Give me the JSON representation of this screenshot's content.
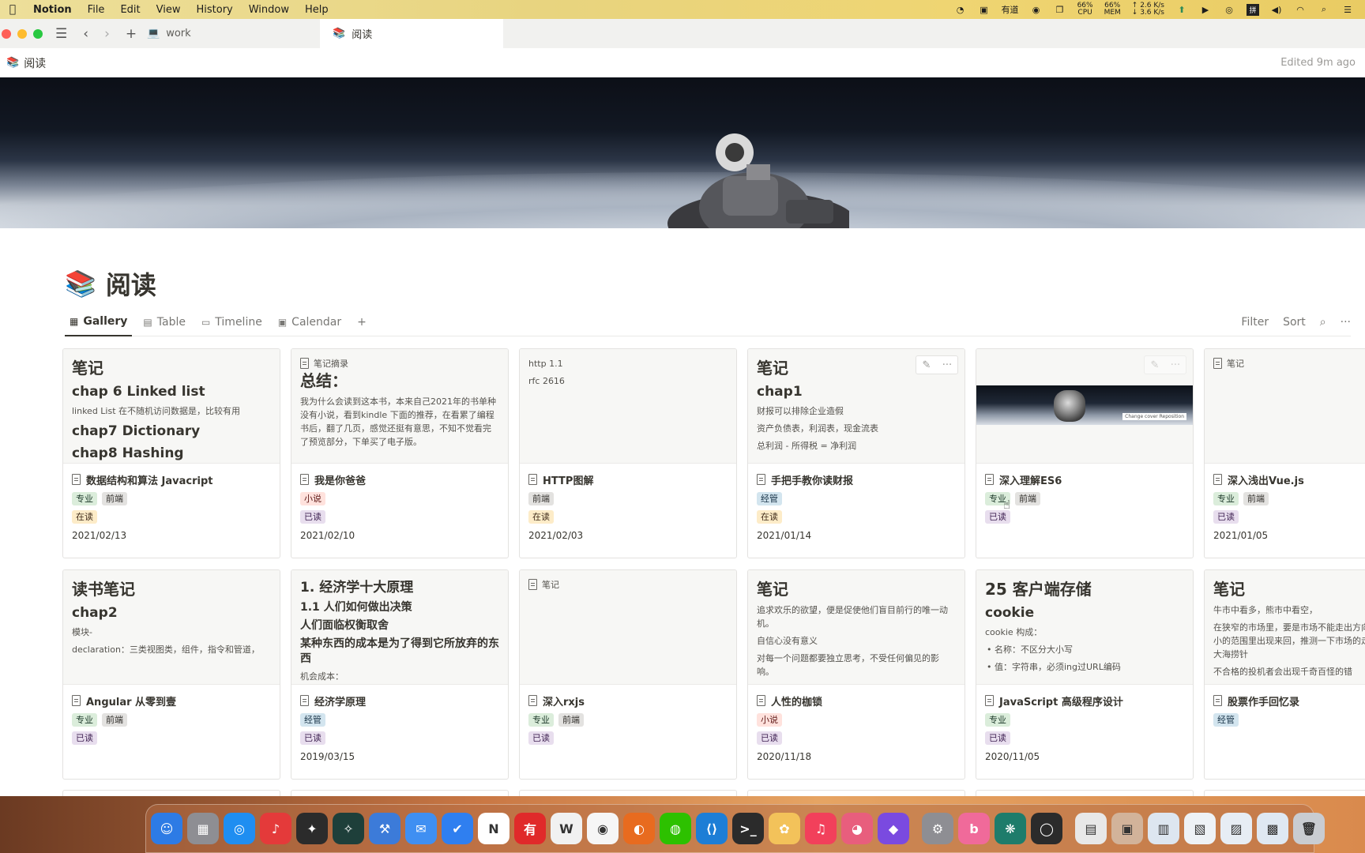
{
  "menubar": {
    "app": "Notion",
    "menus": [
      "File",
      "Edit",
      "View",
      "History",
      "Window",
      "Help"
    ],
    "status": {
      "youdao": "有道",
      "cpu": "66%",
      "cpu_label": "CPU",
      "mem": "66%",
      "mem_label": "MEM",
      "net_up": "↑ 2.6 K/s",
      "net_down": "↓ 3.6 K/s"
    }
  },
  "tabs": [
    {
      "label": "work",
      "icon": "laptop-icon"
    },
    {
      "label": "阅读",
      "icon": "books-icon"
    }
  ],
  "page": {
    "breadcrumb": "阅读",
    "edited": "Edited 9m ago",
    "title": "阅读",
    "emoji": "📚"
  },
  "views": {
    "tabs": [
      "Gallery",
      "Table",
      "Timeline",
      "Calendar"
    ],
    "active": "Gallery",
    "filter": "Filter",
    "sort": "Sort"
  },
  "tag_colors": {
    "专业": {
      "bg": "#dbeddb",
      "fg": "#1c3829"
    },
    "前端": {
      "bg": "#e3e2e0",
      "fg": "#32302c"
    },
    "小说": {
      "bg": "#ffe2dd",
      "fg": "#5d1715"
    },
    "经管": {
      "bg": "#d3e5ef",
      "fg": "#183347"
    },
    "在读": {
      "bg": "#fdecc8",
      "fg": "#402c1b"
    },
    "已读": {
      "bg": "#e8deee",
      "fg": "#412454"
    }
  },
  "cards": [
    {
      "preview": [
        {
          "t": "h1",
          "text": "笔记"
        },
        {
          "t": "h2",
          "text": "chap 6 Linked list"
        },
        {
          "t": "p",
          "text": "linked List  在不随机访问数据是，比较有用"
        },
        {
          "t": "h2",
          "text": "chap7 Dictionary"
        },
        {
          "t": "h2",
          "text": "chap8 Hashing"
        }
      ],
      "title": "数据结构和算法 Javacript",
      "tags": [
        "专业",
        "前端"
      ],
      "status": "在读",
      "date": "2021/02/13"
    },
    {
      "preview": [
        {
          "t": "small",
          "text": "笔记摘录"
        },
        {
          "t": "h1",
          "text": "总结："
        },
        {
          "t": "p",
          "text": "我为什么会读到这本书，本来自己2021年的书单种没有小说，看到kindle 下面的推荐，在看累了编程书后，翻了几页，感觉还挺有意思，不知不觉看完了预览部分，下单买了电子版。"
        }
      ],
      "title": "我是你爸爸",
      "tags": [
        "小说"
      ],
      "status": "已读",
      "date": "2021/02/10"
    },
    {
      "preview": [
        {
          "t": "p",
          "text": "http 1.1"
        },
        {
          "t": "p",
          "text": "rfc 2616"
        }
      ],
      "title": "HTTP图解",
      "tags": [
        "前端"
      ],
      "status": "在读",
      "date": "2021/02/03"
    },
    {
      "preview": [
        {
          "t": "h1",
          "text": "笔记"
        },
        {
          "t": "h2",
          "text": "chap1"
        },
        {
          "t": "p",
          "text": "财报可以排除企业造假"
        },
        {
          "t": "p",
          "text": "资产负债表，利润表，现金流表"
        },
        {
          "t": "p",
          "text": "总利润 - 所得税 = 净利润"
        }
      ],
      "title": "手把手教你读财报",
      "tags": [
        "经管"
      ],
      "status": "在读",
      "date": "2021/01/14",
      "actions": true
    },
    {
      "preview": [],
      "image": true,
      "image_caption": "Change cover  Reposition",
      "title": "深入理解ES6",
      "tags": [
        "专业",
        "前端"
      ],
      "status": "已读",
      "date": "",
      "actions": true
    },
    {
      "preview": [
        {
          "t": "small",
          "text": "笔记"
        }
      ],
      "title": "深入浅出Vue.js",
      "tags": [
        "专业",
        "前端"
      ],
      "status": "已读",
      "date": "2021/01/05"
    },
    {
      "preview": [
        {
          "t": "h1",
          "text": "读书笔记"
        },
        {
          "t": "h2",
          "text": "chap2"
        },
        {
          "t": "p",
          "text": "模块-"
        },
        {
          "t": "p",
          "text": "declaration：三类视图类，组件，指令和管道，"
        }
      ],
      "title": "Angular 从零到壹",
      "tags": [
        "专业",
        "前端"
      ],
      "status": "已读",
      "date": ""
    },
    {
      "preview": [
        {
          "t": "h2",
          "text": "1. 经济学十大原理"
        },
        {
          "t": "h3",
          "text": "1.1 人们如何做出决策"
        },
        {
          "t": "h3",
          "text": "人们面临权衡取舍"
        },
        {
          "t": "h3",
          "text": "某种东西的成本是为了得到它所放弃的东西"
        },
        {
          "t": "p",
          "text": "机会成本："
        }
      ],
      "title": "经济学原理",
      "tags": [
        "经管"
      ],
      "status": "已读",
      "date": "2019/03/15"
    },
    {
      "preview": [
        {
          "t": "small",
          "text": "笔记"
        }
      ],
      "title": "深入rxjs",
      "tags": [
        "专业",
        "前端"
      ],
      "status": "已读",
      "date": ""
    },
    {
      "preview": [
        {
          "t": "h1",
          "text": "笔记"
        },
        {
          "t": "p",
          "text": "追求欢乐的欲望，便是促使他们盲目前行的唯一动机。"
        },
        {
          "t": "p",
          "text": "自信心没有意义"
        },
        {
          "t": "p",
          "text": "对每一个问题都要独立思考，不受任何偏见的影响。"
        }
      ],
      "title": "人性的枷锁",
      "tags": [
        "小说"
      ],
      "status": "已读",
      "date": "2020/11/18"
    },
    {
      "preview": [
        {
          "t": "h1",
          "text": "25 客户端存储"
        },
        {
          "t": "h2",
          "text": "cookie"
        },
        {
          "t": "p",
          "text": "cookie 构成："
        },
        {
          "t": "li",
          "text": "名称：不区分大小写"
        },
        {
          "t": "li",
          "text": "值：字符串，必须ing过URL编码"
        }
      ],
      "title": "JavaScript 高级程序设计",
      "tags": [
        "专业"
      ],
      "status": "已读",
      "date": "2020/11/05"
    },
    {
      "preview": [
        {
          "t": "h1",
          "text": "笔记"
        },
        {
          "t": "p",
          "text": "牛市中看多，熊市中看空，"
        },
        {
          "t": "p",
          "text": "在狭窄的市场里，要是市场不能走出方向，总在这么小的范围里出现来回，推测一下市场的走势，无异于大海捞针"
        },
        {
          "t": "p",
          "text": "不合格的投机者会出现千奇百怪的错"
        }
      ],
      "title": "股票作手回忆录",
      "tags": [
        "经管"
      ],
      "status": "",
      "date": ""
    }
  ],
  "dock": {
    "apps": [
      {
        "name": "finder-icon",
        "color": "#2d7be5",
        "glyph": "☺"
      },
      {
        "name": "launchpad-icon",
        "color": "#8e8e93",
        "glyph": "▦"
      },
      {
        "name": "safari-icon",
        "color": "#1f8ef1",
        "glyph": "◎"
      },
      {
        "name": "netease-music-icon",
        "color": "#e43a3a",
        "glyph": "♪"
      },
      {
        "name": "game-icon",
        "color": "#2b2b2b",
        "glyph": "✦"
      },
      {
        "name": "feather-icon",
        "color": "#1e3f3a",
        "glyph": "✧"
      },
      {
        "name": "xcode-icon",
        "color": "#3c7bd9",
        "glyph": "⚒"
      },
      {
        "name": "mail-icon",
        "color": "#3f8ff2",
        "glyph": "✉"
      },
      {
        "name": "todo-icon",
        "color": "#2f7ff0",
        "glyph": "✔"
      },
      {
        "name": "notion-icon",
        "color": "#ffffff",
        "glyph": "N"
      },
      {
        "name": "youdao-icon",
        "color": "#e02a2a",
        "glyph": "有"
      },
      {
        "name": "wps-icon",
        "color": "#f1f1f1",
        "glyph": "W"
      },
      {
        "name": "chrome-icon",
        "color": "#f6f6f6",
        "glyph": "◉"
      },
      {
        "name": "firefox-icon",
        "color": "#e86b1f",
        "glyph": "◐"
      },
      {
        "name": "wechat-icon",
        "color": "#2dc100",
        "glyph": "◍"
      },
      {
        "name": "vscode-icon",
        "color": "#1d7ed6",
        "glyph": "⟨⟩"
      },
      {
        "name": "terminal-icon",
        "color": "#2b2b2b",
        "glyph": ">_"
      },
      {
        "name": "paw-icon",
        "color": "#f3c25a",
        "glyph": "✿"
      },
      {
        "name": "music-icon",
        "color": "#f2405b",
        "glyph": "♫"
      },
      {
        "name": "mindnode-icon",
        "color": "#e85e7d",
        "glyph": "◕"
      },
      {
        "name": "obsidian-icon",
        "color": "#7a4ae0",
        "glyph": "◆"
      },
      {
        "name": "system-preferences-icon",
        "color": "#8e8e93",
        "glyph": "⚙"
      },
      {
        "name": "bilibili-icon",
        "color": "#f06a9a",
        "glyph": "b"
      },
      {
        "name": "paw-print-icon",
        "color": "#1e7c6b",
        "glyph": "❋"
      },
      {
        "name": "obs-icon",
        "color": "#2b2b2b",
        "glyph": "◯"
      },
      {
        "name": "downloads-folder-icon",
        "color": "#e8e8e8",
        "glyph": "▤"
      },
      {
        "name": "photo-folder-icon",
        "color": "#d2b39a",
        "glyph": "▣"
      },
      {
        "name": "screenshots-folder-icon",
        "color": "#dde6f0",
        "glyph": "▥"
      },
      {
        "name": "documents-folder-icon",
        "color": "#eef2f6",
        "glyph": "▧"
      },
      {
        "name": "files-folder-icon",
        "color": "#e7edf4",
        "glyph": "▨"
      },
      {
        "name": "grid-folder-icon",
        "color": "#dfe8f2",
        "glyph": "▩"
      },
      {
        "name": "trash-icon",
        "color": "#c9ccd1",
        "glyph": "🗑"
      }
    ]
  }
}
